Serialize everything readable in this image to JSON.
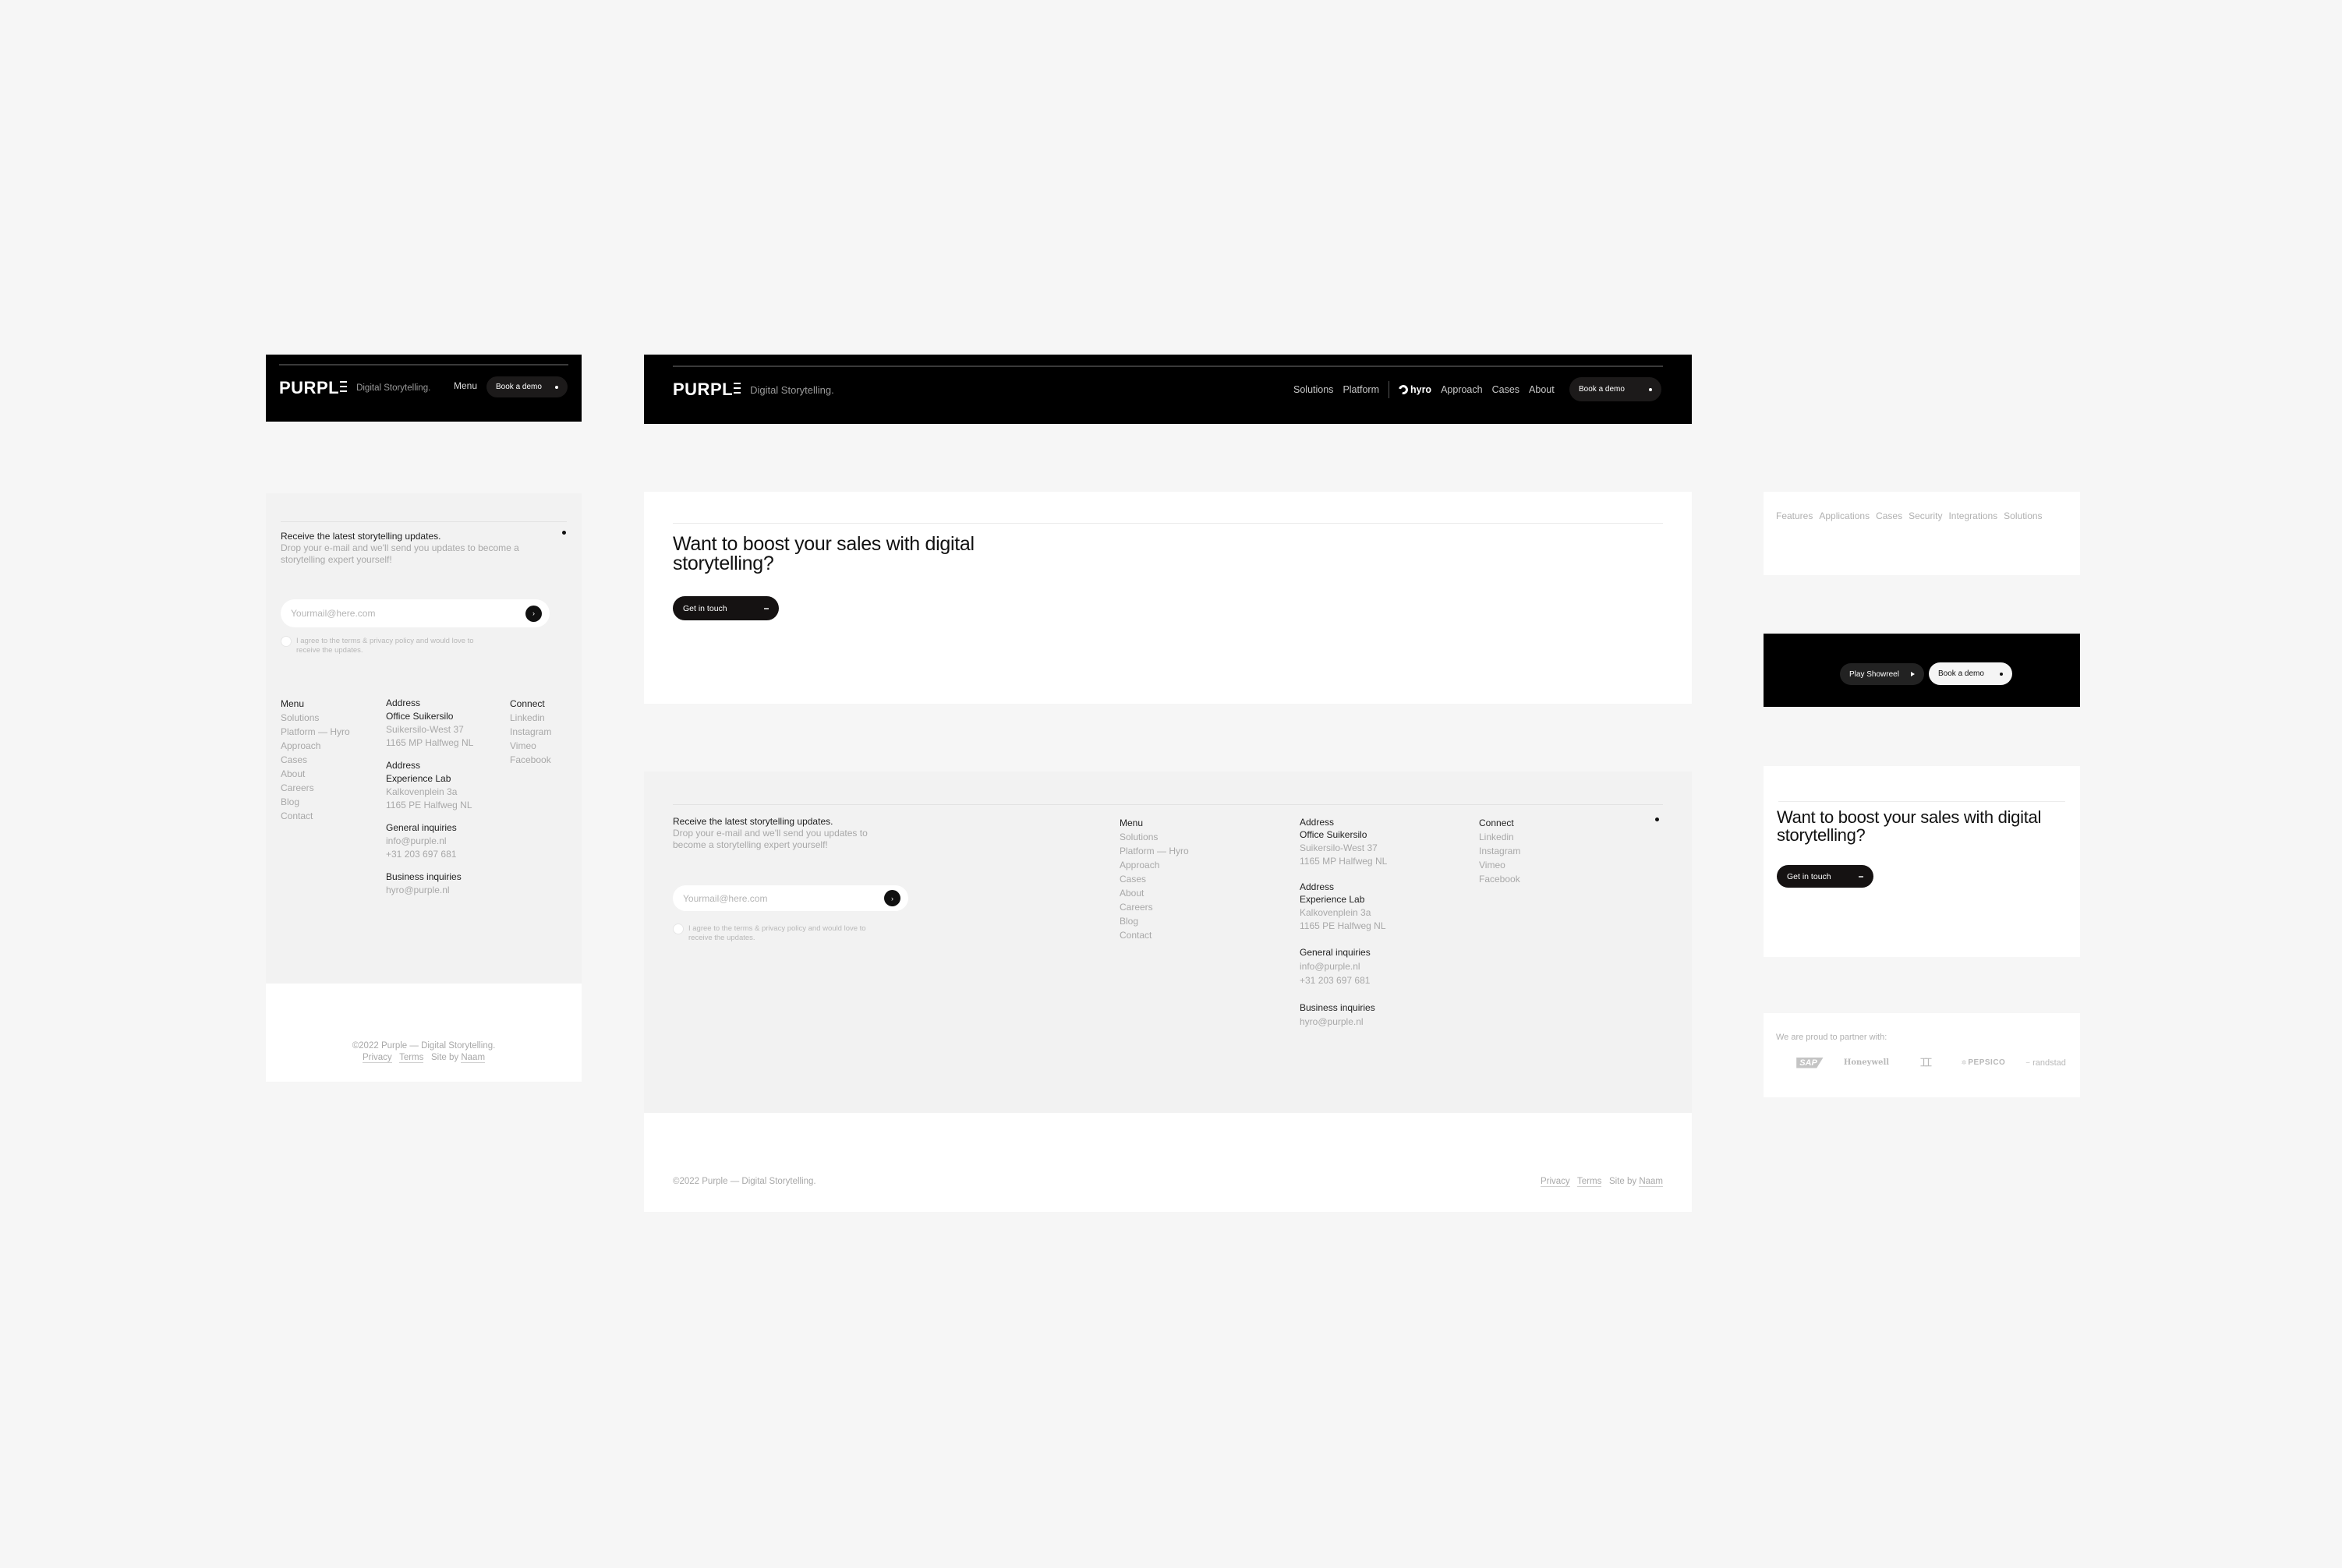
{
  "brand": {
    "logo_text": "PURPL",
    "tagline": "Digital Storytelling."
  },
  "mobile_header": {
    "menu_label": "Menu",
    "cta_label": "Book a demo"
  },
  "desktop_header": {
    "nav": [
      "Solutions",
      "Platform",
      "hyro",
      "Approach",
      "Cases",
      "About"
    ],
    "cta_label": "Book a demo"
  },
  "newsletter": {
    "title": "Receive the latest storytelling updates.",
    "description": "Drop your e-mail and we'll send you updates to become a storytelling expert yourself!",
    "email_placeholder": "Yourmail@here.com",
    "consent": "I agree to the terms & privacy policy and would love to receive the updates."
  },
  "footer": {
    "menu": {
      "heading": "Menu",
      "items": [
        "Solutions",
        "Platform — Hyro",
        "Approach",
        "Cases",
        "About",
        "Careers",
        "Blog",
        "Contact"
      ]
    },
    "addresses": [
      {
        "heading": "Address",
        "name": "Office Suikersilo",
        "line1": "Suikersilo-West 37",
        "line2": "1165 MP Halfweg NL"
      },
      {
        "heading": "Address",
        "name": "Experience Lab",
        "line1": "Kalkovenplein 3a",
        "line2": "1165 PE Halfweg NL"
      }
    ],
    "general": {
      "heading": "General inquiries",
      "email": "info@purple.nl",
      "phone": "+31 203 697 681"
    },
    "business": {
      "heading": "Business inquiries",
      "email": "hyro@purple.nl"
    },
    "connect": {
      "heading": "Connect",
      "items": [
        "Linkedin",
        "Instagram",
        "Vimeo",
        "Facebook"
      ]
    },
    "copyright": "©2022 Purple — Digital Storytelling.",
    "legal": {
      "privacy": "Privacy",
      "terms": "Terms",
      "site_by_prefix": "Site by",
      "site_by_name": "Naam"
    }
  },
  "cta": {
    "title_line1": "Want to boost your sales with digital",
    "title_line2": "storytelling?",
    "button_label": "Get in touch"
  },
  "sub_nav": {
    "items": [
      "Features",
      "Applications",
      "Cases",
      "Security",
      "Integrations",
      "Solutions"
    ]
  },
  "hero_buttons": {
    "showreel_label": "Play Showreel",
    "demo_label": "Book a demo"
  },
  "partners": {
    "title": "We are proud to partner with:",
    "logos": [
      "SAP",
      "Honeywell",
      "Under Armour",
      "PEPSICO",
      "randstad"
    ]
  },
  "colors": {
    "background": "#f6f6f6",
    "header": "#000000",
    "footer_gray": "#f2f2f2",
    "button_dark": "#151212",
    "text_muted": "#a8a8a8"
  }
}
